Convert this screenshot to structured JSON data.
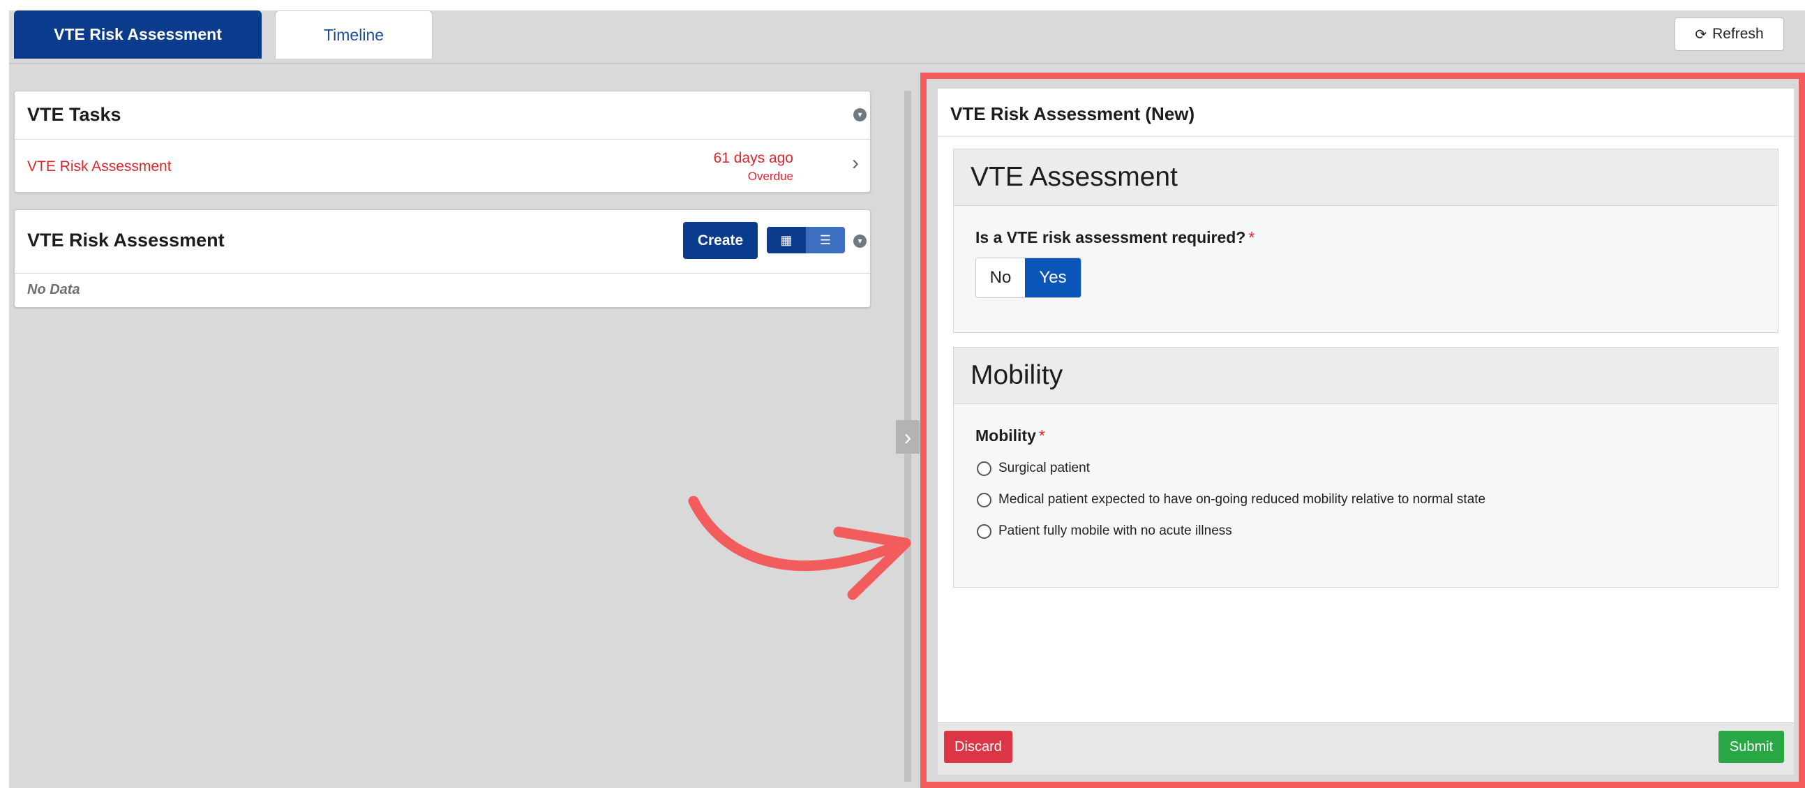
{
  "tabs": [
    {
      "label": "VTE Risk Assessment",
      "active": true
    },
    {
      "label": "Timeline",
      "active": false
    }
  ],
  "toolbar": {
    "refresh_label": "Refresh",
    "refresh_icon": "refresh-icon"
  },
  "tasks_card": {
    "title": "VTE Tasks",
    "items": [
      {
        "label": "VTE Risk Assessment",
        "due": "61 days ago",
        "status": "Overdue"
      }
    ]
  },
  "assessment_card": {
    "title": "VTE Risk Assessment",
    "create_label": "Create",
    "empty_text": "No Data"
  },
  "form": {
    "title": "VTE Risk Assessment (New)",
    "sections": {
      "vte": {
        "heading": "VTE Assessment",
        "question": "Is a VTE risk assessment required?",
        "required_mark": "*",
        "options": [
          "No",
          "Yes"
        ],
        "selected": "Yes"
      },
      "mobility": {
        "heading": "Mobility",
        "question": "Mobility",
        "required_mark": "*",
        "options": [
          "Surgical patient",
          "Medical patient expected to have on-going reduced mobility relative to normal state",
          "Patient fully mobile with no acute illness"
        ]
      }
    },
    "discard_label": "Discard",
    "submit_label": "Submit"
  },
  "colors": {
    "primary": "#0a3b8c",
    "danger": "#dc3545",
    "success": "#28a745",
    "overdue": "#e0252b",
    "annotation": "#f25c5c"
  }
}
